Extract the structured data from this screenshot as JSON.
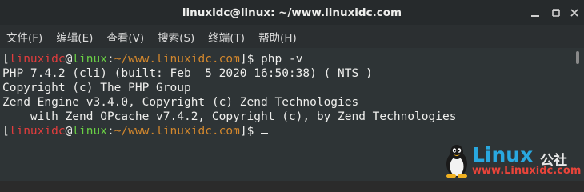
{
  "window": {
    "title": "linuxidc@linux: ~/www.linuxidc.com"
  },
  "menu": {
    "items": [
      {
        "label": "文件(F)"
      },
      {
        "label": "编辑(E)"
      },
      {
        "label": "查看(V)"
      },
      {
        "label": "搜索(S)"
      },
      {
        "label": "终端(T)"
      },
      {
        "label": "帮助(H)"
      }
    ]
  },
  "terminal": {
    "prompt1": {
      "open": "[",
      "user": "linuxidc",
      "at": "@",
      "host": "linux",
      "sep": ":",
      "path": "~/www.linuxidc.com",
      "close": "]$ ",
      "command": "php -v"
    },
    "output": [
      "PHP 7.4.2 (cli) (built: Feb  5 2020 16:50:38) ( NTS )",
      "Copyright (c) The PHP Group",
      "Zend Engine v3.4.0, Copyright (c) Zend Technologies",
      "    with Zend OPcache v7.4.2, Copyright (c), by Zend Technologies"
    ],
    "prompt2": {
      "open": "[",
      "user": "linuxidc",
      "at": "@",
      "host": "linux",
      "sep": ":",
      "path": "~/www.linuxidc.com",
      "close": "]$ "
    }
  },
  "watermark": {
    "brand": "Linux",
    "brand_cn": "公社",
    "url": "www.Linuxidc.com"
  },
  "colors": {
    "user": "#e13d3d",
    "host": "#6ad145",
    "path": "#d2872d",
    "text": "#eeeeec",
    "background": "#2e3436",
    "titlebar": "#262a2c",
    "brand": "#29a8e0"
  },
  "icons": {
    "minimize": "minimize-icon",
    "maximize": "maximize-icon",
    "close": "close-icon",
    "mascot": "tux-penguin-icon"
  }
}
